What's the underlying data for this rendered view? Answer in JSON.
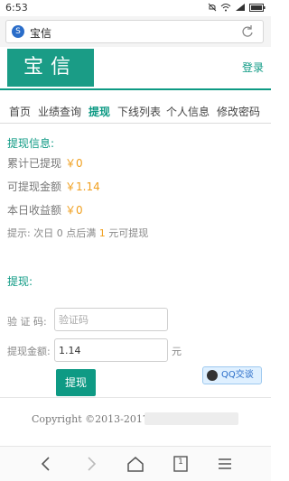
{
  "status_bar": {
    "time": "6:53"
  },
  "browser": {
    "tab_title": "宝信",
    "favicon_char": "S"
  },
  "site": {
    "logo_text": "宝信",
    "login_label": "登录"
  },
  "nav": {
    "items": [
      "首页",
      "业绩查询",
      "提现",
      "下线列表",
      "个人信息",
      "修改密码"
    ],
    "active": "提现"
  },
  "withdraw_info": {
    "title": "提现信息:",
    "rows": [
      {
        "label": "累计已提现",
        "value": "￥0"
      },
      {
        "label": "可提现金额",
        "value": "￥1.14"
      },
      {
        "label": "本日收益额",
        "value": "￥0"
      }
    ],
    "hint_prefix": "提示: 次日 0 点后满",
    "hint_number": "1",
    "hint_suffix": "元可提现"
  },
  "withdraw_form": {
    "title": "提现:",
    "captcha_label": "验 证 码:",
    "captcha_placeholder": "验证码",
    "amount_label": "提现金额:",
    "amount_value": "1.14",
    "unit": "元",
    "submit_label": "提现"
  },
  "qq_chat_label": "QQ交谈",
  "footer": {
    "copyright": "Copyright ©2013-2017"
  },
  "bottom_bar": {
    "tab_count": "1"
  },
  "colors": {
    "accent": "#0e9a84",
    "value": "#f0a020"
  }
}
